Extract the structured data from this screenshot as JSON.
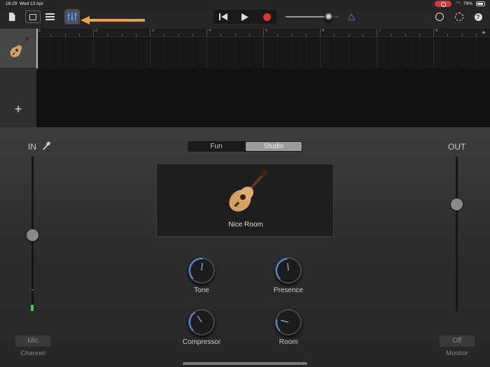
{
  "status_bar": {
    "time": "16:29",
    "date": "Wed 13 Apr",
    "battery": "79%",
    "wifi_icon": "wifi-icon"
  },
  "toolbar": {
    "icons": [
      "document-icon",
      "browser-view-icon",
      "tracks-view-icon",
      "mixer-icon"
    ],
    "volume_level": 0.8,
    "accent_color": "#4d8ff0",
    "arrow_color": "#f0a23a",
    "record_color": "#e8312f"
  },
  "ruler": {
    "bars": [
      "1",
      "2",
      "3",
      "4",
      "5",
      "6",
      "7",
      "8"
    ],
    "add_label": "+"
  },
  "tracks": {
    "add_label": "+"
  },
  "smart_controls": {
    "in_label": "IN",
    "out_label": "OUT",
    "mode_fun": "Fun",
    "mode_studio": "Studio",
    "preset_name": "Nice Room",
    "knobs": [
      {
        "label": "Tone",
        "value": 0.52
      },
      {
        "label": "Presence",
        "value": 0.48
      },
      {
        "label": "Compressor",
        "value": 0.38
      },
      {
        "label": "Room",
        "value": 0.22
      }
    ],
    "input_button": "Mic",
    "input_caption": "Channel",
    "monitor_button": "Off",
    "monitor_caption": "Monitor"
  }
}
